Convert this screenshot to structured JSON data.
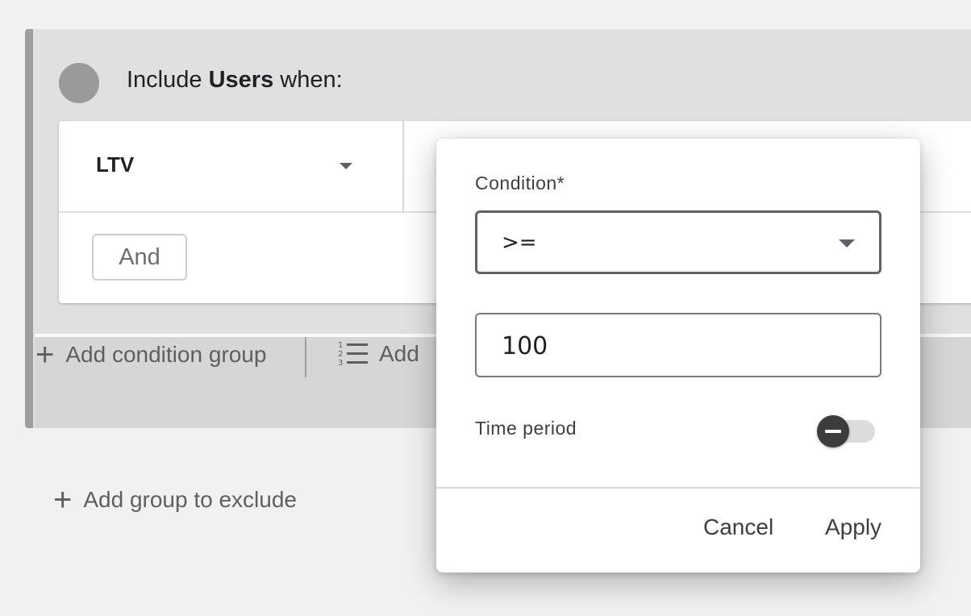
{
  "group": {
    "title_prefix": "Include",
    "title_scope": "Users",
    "title_suffix": "when:",
    "dimension": "LTV",
    "and_label": "And",
    "add_condition_group": "Add condition group",
    "add_sequence_partial": "Add"
  },
  "exclude": {
    "add_group": "Add group to exclude"
  },
  "popup": {
    "condition_label": "Condition*",
    "condition_value": ">=",
    "value_input": "100",
    "time_period_label": "Time period",
    "time_period_enabled": false,
    "cancel_label": "Cancel",
    "apply_label": "Apply"
  },
  "icons": {
    "plus": "+",
    "add_sequence_icon": "numbered-list-icon"
  }
}
